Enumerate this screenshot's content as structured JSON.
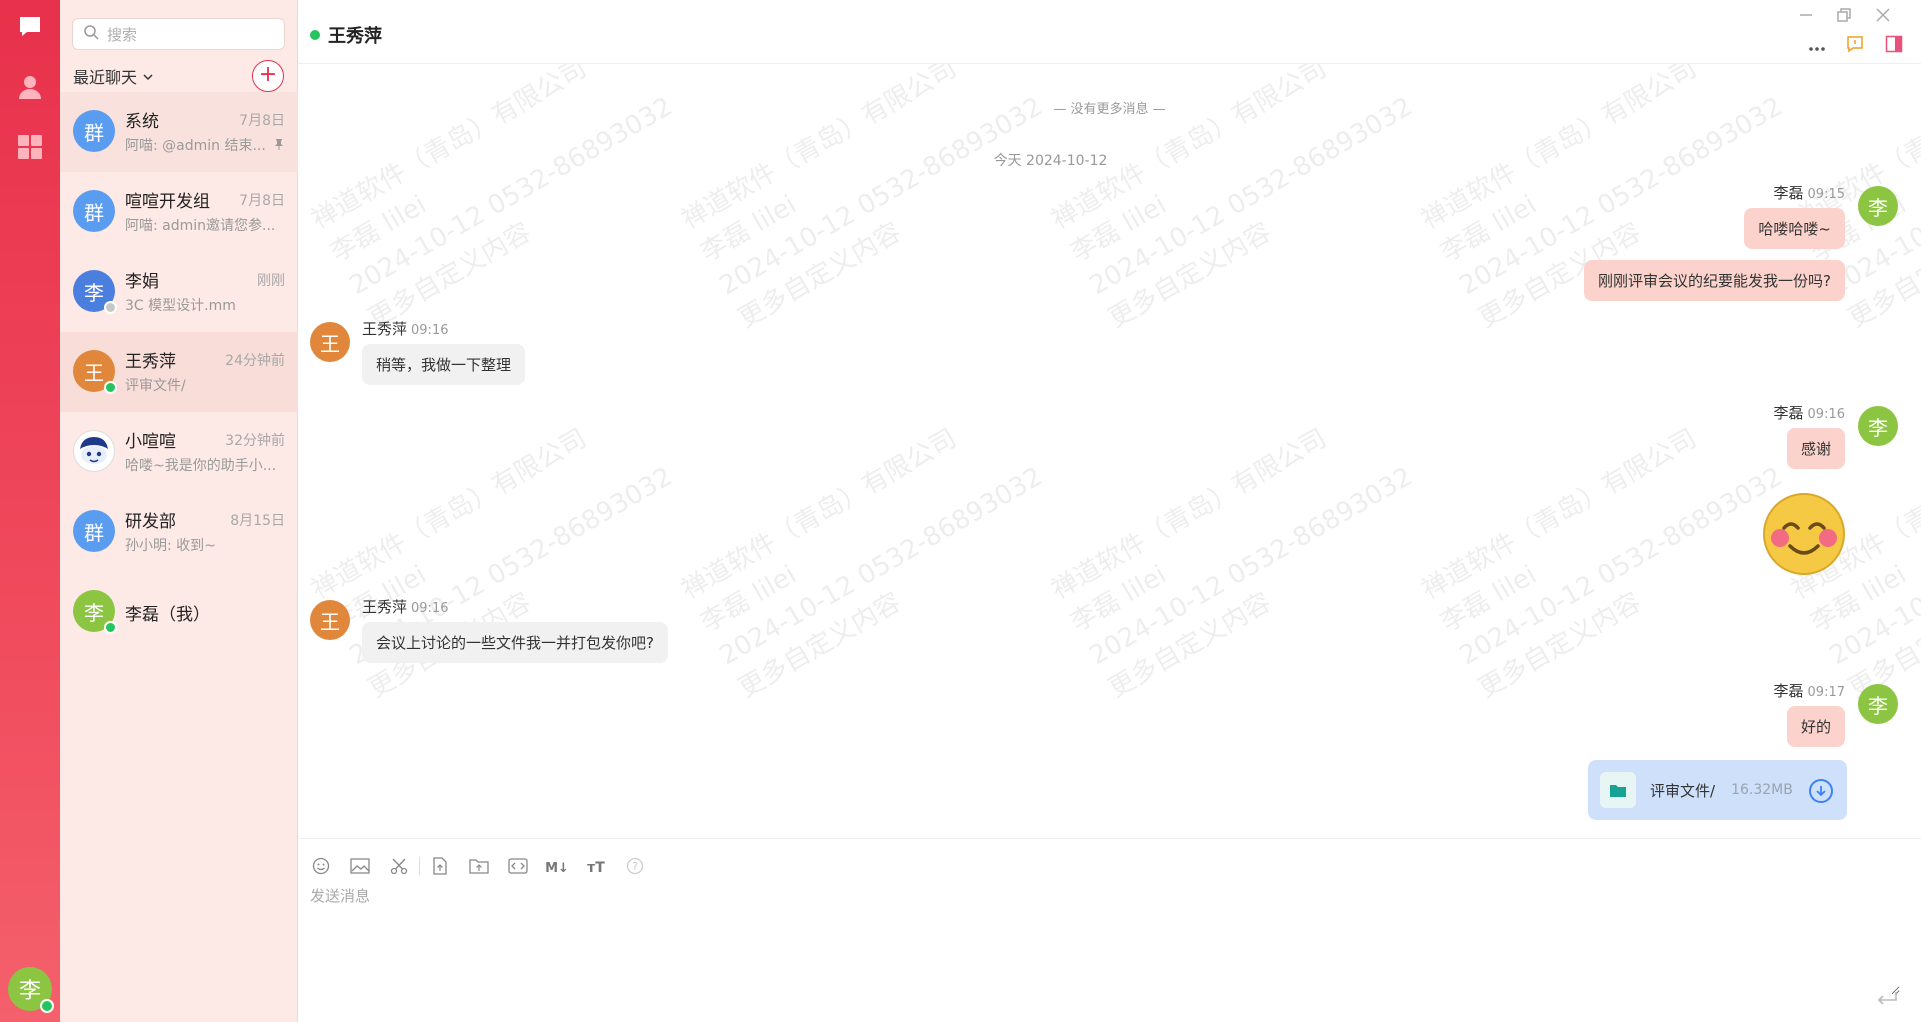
{
  "rail": {
    "items": [
      {
        "name": "chat",
        "icon": "chat-bubble-icon"
      },
      {
        "name": "contacts",
        "icon": "user-icon"
      },
      {
        "name": "apps",
        "icon": "grid-icon"
      }
    ],
    "user_avatar": "李"
  },
  "sidebar": {
    "search_placeholder": "搜索",
    "recent_label": "最近聊天",
    "add_label": "+",
    "conversations": [
      {
        "avatar": "群",
        "name": "系统",
        "time": "7月8日",
        "preview": "阿喵: @admin 结束...",
        "color": "#5a9cf0",
        "pinned": true
      },
      {
        "avatar": "群",
        "name": "喧喧开发组",
        "time": "7月8日",
        "preview": "阿喵: admin邀请您参...",
        "color": "#5a9cf0"
      },
      {
        "avatar": "李",
        "name": "李娟",
        "time": "刚刚",
        "preview": "3C 模型设计.mm",
        "color": "#4a7fe0",
        "status": "offline"
      },
      {
        "avatar": "王",
        "name": "王秀萍",
        "time": "24分钟前",
        "preview": "评审文件/",
        "color": "#e0873c",
        "status": "online",
        "active": true
      },
      {
        "avatar": "",
        "name": "小喧喧",
        "time": "32分钟前",
        "preview": "哈喽~我是你的助手小...",
        "color": "#ffffff"
      },
      {
        "avatar": "群",
        "name": "研发部",
        "time": "8月15日",
        "preview": "孙小明: 收到~",
        "color": "#5a9cf0"
      },
      {
        "avatar": "李",
        "name": "李磊（我）",
        "time": "",
        "preview": "",
        "color": "#8bc541",
        "status": "online"
      }
    ]
  },
  "header": {
    "title": "王秀萍",
    "status": "online"
  },
  "watermark": {
    "line1": "禅道软件（青岛）有限公司",
    "line2": "李磊 lilei",
    "line3": "2024-10-12 0532-86893032",
    "line4": "更多自定义内容"
  },
  "chat": {
    "no_more": "— 没有更多消息 —",
    "date_divider": "今天 2024-10-12",
    "messages": [
      {
        "sender": "李磊",
        "time": "09:15",
        "text": "哈喽哈喽~",
        "out": true
      },
      {
        "sender": "李磊",
        "time": "",
        "text": "刚刚评审会议的纪要能发我一份吗?",
        "out": true
      },
      {
        "sender": "王秀萍",
        "time": "09:16",
        "text": "稍等，我做一下整理",
        "out": false
      },
      {
        "sender": "李磊",
        "time": "09:16",
        "text": "感谢",
        "out": true
      },
      {
        "sender": "李磊",
        "time": "",
        "text": "",
        "emoji": "smile-blush-emoji",
        "out": true
      },
      {
        "sender": "王秀萍",
        "time": "09:16",
        "text": "会议上讨论的一些文件我一并打包发你吧?",
        "out": false
      },
      {
        "sender": "李磊",
        "time": "09:17",
        "text": "好的",
        "out": true
      },
      {
        "sender": "李磊",
        "time": "",
        "file": {
          "name": "评审文件/",
          "size": "16.32MB"
        },
        "out": true
      }
    ]
  },
  "composer": {
    "placeholder": "发送消息",
    "tools": [
      "emoji-icon",
      "image-icon",
      "scissors-icon",
      "file-icon",
      "folder-icon",
      "code-icon",
      "markdown-icon",
      "text-size-icon",
      "help-icon"
    ]
  }
}
